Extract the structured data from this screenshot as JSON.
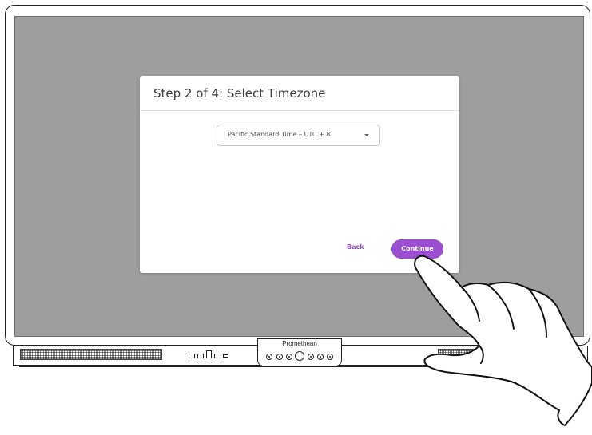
{
  "dialog": {
    "title": "Step 2 of 4: Select Timezone",
    "timezone_select": {
      "value": "Pacific Standard Time – UTC + 8",
      "icon": "caret-down-icon"
    },
    "back_label": "Back",
    "continue_label": "Continue"
  },
  "device": {
    "brand": "Promethean"
  },
  "colors": {
    "accent": "#9b4fd0",
    "screen_background": "#9e9e9e",
    "dialog_background": "#ffffff"
  }
}
